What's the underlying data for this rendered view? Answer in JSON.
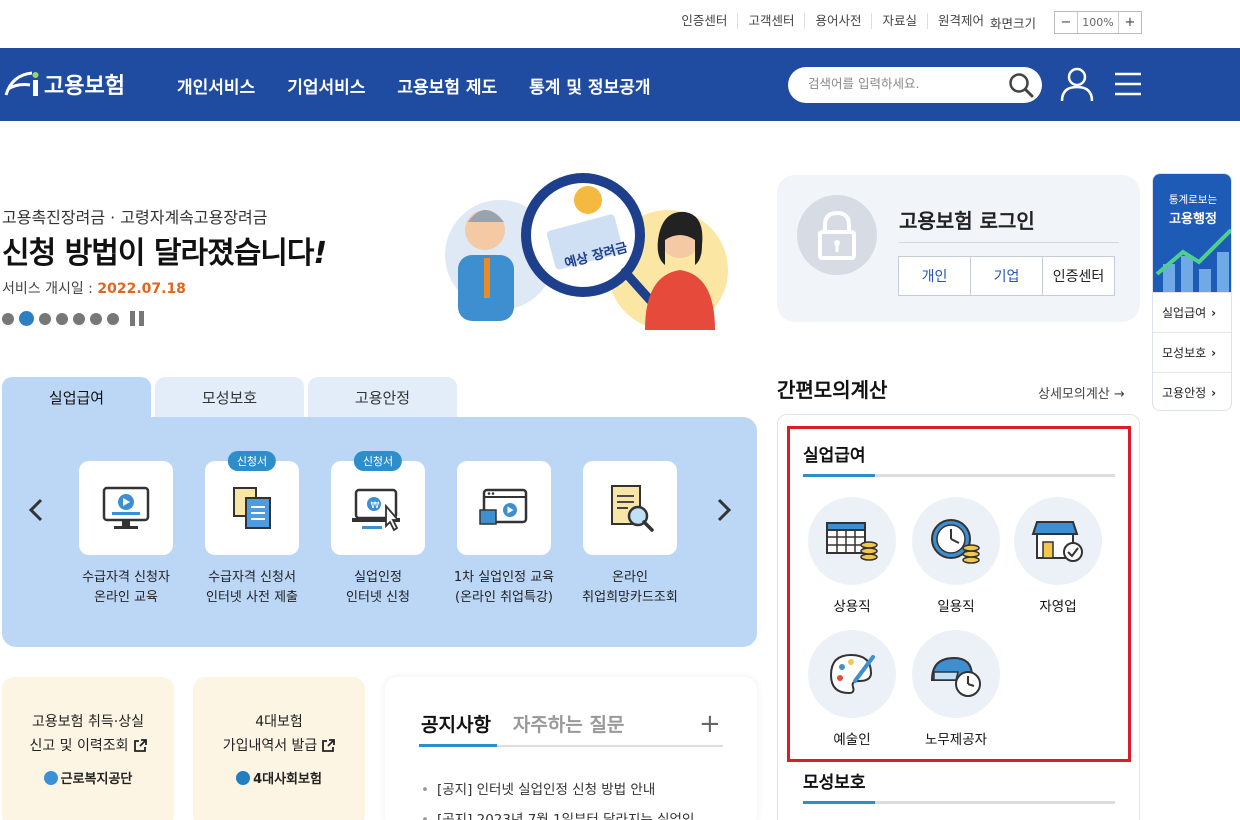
{
  "util": {
    "links": [
      "인증센터",
      "고객센터",
      "용어사전",
      "자료실",
      "원격제어"
    ],
    "zoom_label": "화면크기",
    "zoom_minus": "−",
    "zoom_value": "100%",
    "zoom_plus": "+"
  },
  "nav": {
    "logo_text": "고용보험",
    "menu": [
      "개인서비스",
      "기업서비스",
      "고용보험 제도",
      "통계 및 정보공개"
    ],
    "search_placeholder": "검색어를 입력하세요."
  },
  "hero": {
    "subtitle": "고용촉진장려금 · 고령자계속고용장려금",
    "title": "신청 방법이 달라졌습니다",
    "title_mark": "!",
    "date_label": "서비스 개시일 : ",
    "date_value": "2022.07.18",
    "art_text": "예상 장려금",
    "dots_total": 7,
    "active_dot": 2
  },
  "login": {
    "title": "고용보험 로그인",
    "buttons": [
      "개인",
      "기업",
      "인증센터"
    ]
  },
  "quick": {
    "banner_line1": "통계로보는",
    "banner_line2": "고용행정",
    "items": [
      "실업급여",
      "모성보호",
      "고용안정"
    ]
  },
  "tabs": {
    "items": [
      "실업급여",
      "모성보호",
      "고용안정"
    ],
    "active": 0,
    "services": [
      {
        "line1": "수급자격 신청자",
        "line2": "온라인 교육",
        "badge": ""
      },
      {
        "line1": "수급자격 신청서",
        "line2": "인터넷 사전 제출",
        "badge": "신청서"
      },
      {
        "line1": "실업인정",
        "line2": "인터넷 신청",
        "badge": "신청서"
      },
      {
        "line1": "1차 실업인정 교육",
        "line2": "(온라인 취업특강)",
        "badge": ""
      },
      {
        "line1": "온라인",
        "line2": "취업희망카드조회",
        "badge": ""
      }
    ]
  },
  "cards": [
    {
      "line1": "고용보험 취득·상실",
      "line2": "신고 및 이력조회",
      "org": "근로복지공단"
    },
    {
      "line1": "4대보험",
      "line2": "가입내역서 발급",
      "org": "4대사회보험"
    }
  ],
  "notice": {
    "tabs": [
      "공지사항",
      "자주하는 질문"
    ],
    "plus": "+",
    "items": [
      "[공지] 인터넷 실업인정 신청 방법 안내",
      "[공지] 2023년 7월 1일부터 달라지는 실업인"
    ]
  },
  "calc": {
    "title": "간편모의계산",
    "more": "상세모의계산 →",
    "section1": "실업급여",
    "items": [
      "상용직",
      "일용직",
      "자영업",
      "예술인",
      "노무제공자"
    ],
    "section2": "모성보호"
  }
}
